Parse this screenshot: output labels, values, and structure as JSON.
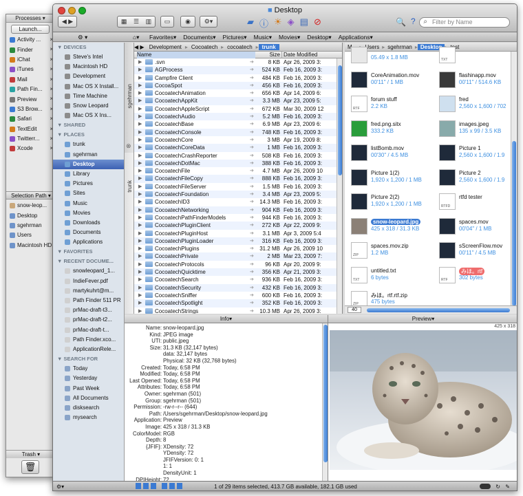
{
  "left_panel": {
    "processes_header": "Processes",
    "launch_button": "Launch...",
    "processes": [
      "Activity ...",
      "Finder",
      "iChat",
      "iTunes",
      "Mail",
      "Path Fin...",
      "Preview",
      "S3 Brow...",
      "Safari",
      "TextEdit",
      "Twitterr...",
      "Xcode"
    ],
    "selection_path_header": "Selection Path",
    "selection_path": [
      "snow-leop...",
      "Desktop",
      "sgehrman",
      "Users",
      "Macintosh HD"
    ],
    "trash_header": "Trash"
  },
  "window": {
    "title": "Desktop",
    "search_placeholder": "Filter by Name",
    "favorites_bar": [
      "Favorites",
      "Documents",
      "Pictures",
      "Music",
      "Movies",
      "Desktop",
      "Applications"
    ]
  },
  "sidebar": {
    "devices_header": "DEVICES",
    "devices": [
      "Steve's Intel",
      "Macintosh HD",
      "Development",
      "Mac OS X Install...",
      "Time Machine",
      "Snow Leopard",
      "Mac OS X Ins..."
    ],
    "shared_header": "SHARED",
    "places_header": "PLACES",
    "places": [
      "trunk",
      "sgehrman",
      "Desktop",
      "Library",
      "Pictures",
      "Sites",
      "Music",
      "Movies",
      "Downloads",
      "Documents",
      "Applications"
    ],
    "favorites_header": "FAVORITES",
    "recent_header": "RECENT DOCUME...",
    "recent": [
      "snowleopard_1...",
      "IndieFever.pdf",
      "martykuhrt@m...",
      "Path Finder 511 PR",
      "prMac-draft-t3...",
      "prMac-draft-t2...",
      "prMac-draft-t...",
      "Path Finder.xco...",
      "ApplicationRele..."
    ],
    "search_header": "SEARCH FOR",
    "search": [
      "Today",
      "Yesterday",
      "Past Week",
      "All Documents",
      "disksearch",
      "mysearch"
    ]
  },
  "list_pane": {
    "vertical_tab_top": "sgehrman",
    "vertical_tab_bottom": "trunk",
    "breadcrumb": [
      "Development",
      "Cocoatech",
      "cocoatech",
      "trunk"
    ],
    "columns": [
      "Name",
      "Size",
      "Date Modified"
    ],
    "rows": [
      {
        "name": ".svn",
        "size": "8 KB",
        "date": "Apr 26, 2009 3:"
      },
      {
        "name": "AGProcess",
        "size": "524 KB",
        "date": "Feb 16, 2009 3:"
      },
      {
        "name": "Campfire Client",
        "size": "484 KB",
        "date": "Feb 16, 2009 3:"
      },
      {
        "name": "CocoaSpot",
        "size": "456 KB",
        "date": "Feb 16, 2009 3:"
      },
      {
        "name": "CocoatechAnimation",
        "size": "656 KB",
        "date": "Apr 14, 2009 6:"
      },
      {
        "name": "CocoatechAppKit",
        "size": "3.3 MB",
        "date": "Apr 23, 2009 5:"
      },
      {
        "name": "CocoatechAppleScript",
        "size": "672 KB",
        "date": "Mar 30, 2009 12"
      },
      {
        "name": "CocoatechAudio",
        "size": "5.2 MB",
        "date": "Feb 16, 2009 3:"
      },
      {
        "name": "CocoatechBase",
        "size": "6.9 MB",
        "date": "Apr 23, 2009 6:"
      },
      {
        "name": "CocoatechConsole",
        "size": "748 KB",
        "date": "Feb 16, 2009 3:"
      },
      {
        "name": "CocoatechCore",
        "size": "3 MB",
        "date": "Apr 19, 2009 8:"
      },
      {
        "name": "CocoatechCoreData",
        "size": "1 MB",
        "date": "Feb 16, 2009 3:"
      },
      {
        "name": "CocoatechCrashReporter",
        "size": "508 KB",
        "date": "Feb 16, 2009 3:"
      },
      {
        "name": "CocoatechDotMac",
        "size": "388 KB",
        "date": "Feb 16, 2009 3:"
      },
      {
        "name": "CocoatechFile",
        "size": "4.7 MB",
        "date": "Apr 26, 2009 10"
      },
      {
        "name": "CocoatechFileCopy",
        "size": "888 KB",
        "date": "Feb 16, 2009 3:"
      },
      {
        "name": "CocoatechFileServer",
        "size": "1.5 MB",
        "date": "Feb 16, 2009 3:"
      },
      {
        "name": "CocoatechFoundation",
        "size": "3.4 MB",
        "date": "Apr 23, 2009 5:"
      },
      {
        "name": "CocoatechID3",
        "size": "14.3 MB",
        "date": "Feb 16, 2009 3:"
      },
      {
        "name": "CocoatechNetworking",
        "size": "904 KB",
        "date": "Feb 16, 2009 3:"
      },
      {
        "name": "CocoatechPathFinderModels",
        "size": "944 KB",
        "date": "Feb 16, 2009 3:"
      },
      {
        "name": "CocoatechPluginClient",
        "size": "272 KB",
        "date": "Apr 22, 2009 9:"
      },
      {
        "name": "CocoatechPluginHost",
        "size": "3.1 MB",
        "date": "Apr 3, 2009 5:4"
      },
      {
        "name": "CocoatechPluginLoader",
        "size": "316 KB",
        "date": "Feb 16, 2009 3:"
      },
      {
        "name": "CocoatechPlugins",
        "size": "31.2 MB",
        "date": "Apr 26, 2009 10"
      },
      {
        "name": "CocoatechPrivate",
        "size": "2 MB",
        "date": "Mar 23, 2009 7:"
      },
      {
        "name": "CocoatechProtocols",
        "size": "96 KB",
        "date": "Apr 20, 2009 9:"
      },
      {
        "name": "CocoatechQuicktime",
        "size": "356 KB",
        "date": "Apr 21, 2009 3:"
      },
      {
        "name": "CocoatechSearch",
        "size": "936 KB",
        "date": "Feb 16, 2009 3:"
      },
      {
        "name": "CocoatechSecurity",
        "size": "432 KB",
        "date": "Feb 16, 2009 3:"
      },
      {
        "name": "CocoatechSniffer",
        "size": "600 KB",
        "date": "Feb 16, 2009 3:"
      },
      {
        "name": "CocoatechSpotlight",
        "size": "352 KB",
        "date": "Feb 16, 2009 3:"
      },
      {
        "name": "CocoatechStrings",
        "size": "10.3 MB",
        "date": "Apr 26, 2009 3:"
      }
    ]
  },
  "icon_pane": {
    "breadcrumb": [
      "M...",
      "Users",
      "sgehrman",
      "Desktop",
      "test"
    ],
    "zoom": "40",
    "items": [
      {
        "name": "",
        "sub": "05.49 x 1.8 MB"
      },
      {
        "name": "",
        "sub": "",
        "tag": "TXT"
      },
      {
        "name": "CoreAnimation.mov",
        "sub": "00'11\" / 1 MB"
      },
      {
        "name": "flashinapp.mov",
        "sub": "00'11\" / 514.6 KB"
      },
      {
        "name": "forum stuff",
        "sub": "2.2 KB",
        "tag": "RTF"
      },
      {
        "name": "fred",
        "sub": "2,560 x 1,600 / 702"
      },
      {
        "name": "fred.png.sitx",
        "sub": "333.2 KB"
      },
      {
        "name": "images.jpeg",
        "sub": "135 x 99 / 3.5 KB"
      },
      {
        "name": "listBomb.mov",
        "sub": "00'30\" / 4.5 MB"
      },
      {
        "name": "Picture 1",
        "sub": "2,560 x 1,600 / 1.9"
      },
      {
        "name": "Picture 1(2)",
        "sub": "1,920 x 1,200 / 1 MB"
      },
      {
        "name": "Picture 2",
        "sub": "2,560 x 1,600 / 1.9"
      },
      {
        "name": "Picture 2(2)",
        "sub": "1,920 x 1,200 / 1 MB"
      },
      {
        "name": "rtfd tester",
        "sub": "",
        "tag": "RTFD"
      },
      {
        "name": "snow-leopard.jpg",
        "sub": "425 x 318 / 31.3 KB",
        "selected": "true"
      },
      {
        "name": "spaces.mov",
        "sub": "00'04\" / 1 MB"
      },
      {
        "name": "spaces.mov.zip",
        "sub": "1.2 MB",
        "tag": "ZIP"
      },
      {
        "name": "sScreenFlow.mov",
        "sub": "00'11\" / 4.5 MB"
      },
      {
        "name": "untitled.txt",
        "sub": "6 bytes",
        "tag": "TXT"
      },
      {
        "name": "みほ。rtf",
        "sub": "302 bytes",
        "tag": "RTF",
        "label": "true"
      },
      {
        "name": "みほ。rtf.rtf.zip",
        "sub": "475 bytes",
        "tag": "ZIP"
      }
    ]
  },
  "info_pane": {
    "header": "Info",
    "rows": [
      {
        "k": "Name:",
        "v": "snow-leopard.jpg"
      },
      {
        "k": "Kind:",
        "v": "JPEG image"
      },
      {
        "k": "UTI:",
        "v": "public.jpeg"
      },
      {
        "k": "Size:",
        "v": "31.3 KB (32,147 bytes)"
      },
      {
        "k": "",
        "v": "data: 32,147 bytes"
      },
      {
        "k": "",
        "v": "Physical: 32 KB (32,768 bytes)"
      },
      {
        "k": "Created:",
        "v": "Today, 6:58 PM"
      },
      {
        "k": "Modified:",
        "v": "Today, 6:58 PM"
      },
      {
        "k": "Last Opened:",
        "v": "Today, 6:58 PM"
      },
      {
        "k": "Attributes:",
        "v": "Today, 6:58 PM"
      },
      {
        "k": "Owner:",
        "v": "sgehrman (501)"
      },
      {
        "k": "Group:",
        "v": "sgehrman (501)"
      },
      {
        "k": "Permission:",
        "v": "-rw-r--r-- (644)"
      },
      {
        "k": "Path:",
        "v": "/Users/sgehrman/Desktop/snow-leopard.jpg"
      },
      {
        "k": "Application:",
        "v": "Preview"
      },
      {
        "k": "Image:",
        "v": "425 x 318 / 31.3 KB"
      },
      {
        "k": "ColorModel:",
        "v": "RGB"
      },
      {
        "k": "Depth:",
        "v": "8"
      },
      {
        "k": "{JFIF}:",
        "v": "XDensity: 72"
      },
      {
        "k": "",
        "v": "YDensity: 72"
      },
      {
        "k": "",
        "v": "JFIFVersion: 0: 1"
      },
      {
        "k": "",
        "v": "1: 1"
      },
      {
        "k": "",
        "v": "DensityUnit: 1"
      },
      {
        "k": "DPIHeight:",
        "v": "72"
      },
      {
        "k": "PixelWidth:",
        "v": "425"
      }
    ]
  },
  "preview_pane": {
    "header": "Preview",
    "dimensions": "425 x 318"
  },
  "status": {
    "text": "1 of 29 items selected, 413.7 GB available, 182.1 GB used"
  }
}
